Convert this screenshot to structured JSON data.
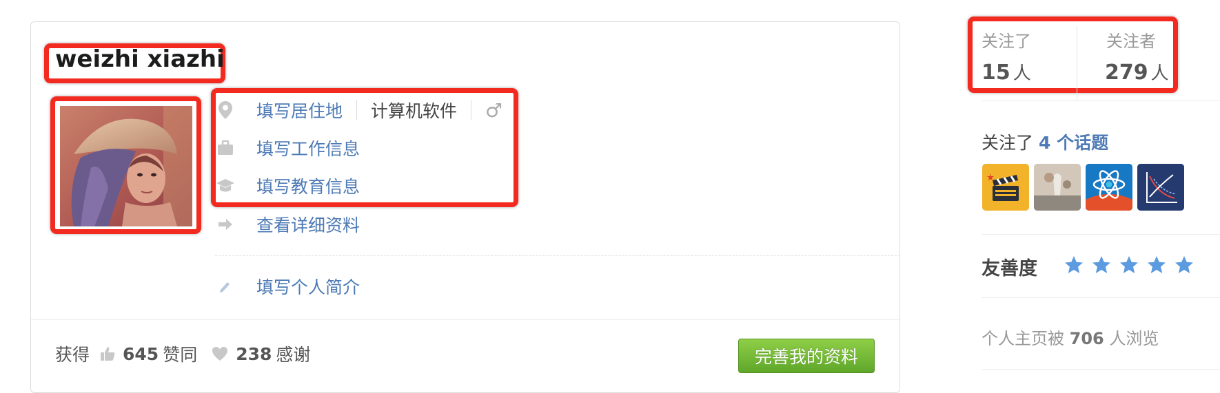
{
  "profile": {
    "username": "weizhi xiazhi",
    "location_link": "填写居住地",
    "industry": "计算机软件",
    "gender_symbol": "♂",
    "work_link": "填写工作信息",
    "education_link": "填写教育信息",
    "details_link": "查看详细资料",
    "bio_link": "填写个人简介"
  },
  "stats": {
    "got_label": "获得",
    "agree_count": "645",
    "agree_label": "赞同",
    "thanks_count": "238",
    "thanks_label": "感谢"
  },
  "actions": {
    "complete_button": "完善我的资料"
  },
  "sidebar": {
    "following_label": "关注了",
    "following_count": "15",
    "following_unit": "人",
    "followers_label": "关注者",
    "followers_count": "279",
    "followers_unit": "人",
    "topics_prefix": "关注了",
    "topics_link": "4 个话题",
    "friendliness_label": "友善度",
    "friendliness_stars": 5,
    "views_prefix": "个人主页被",
    "views_count": "706",
    "views_suffix": "人浏览"
  },
  "icons": {
    "location": "location-pin-icon",
    "work": "briefcase-icon",
    "education": "graduation-cap-icon",
    "details": "arrow-right-icon",
    "bio": "pencil-icon",
    "agree": "thumbs-up-icon",
    "thanks": "heart-icon",
    "star": "star-icon"
  },
  "colors": {
    "link": "#4e7ab5",
    "highlight": "#f22a1f",
    "button_green": "#6fb534",
    "star_blue": "#5c9be0"
  }
}
